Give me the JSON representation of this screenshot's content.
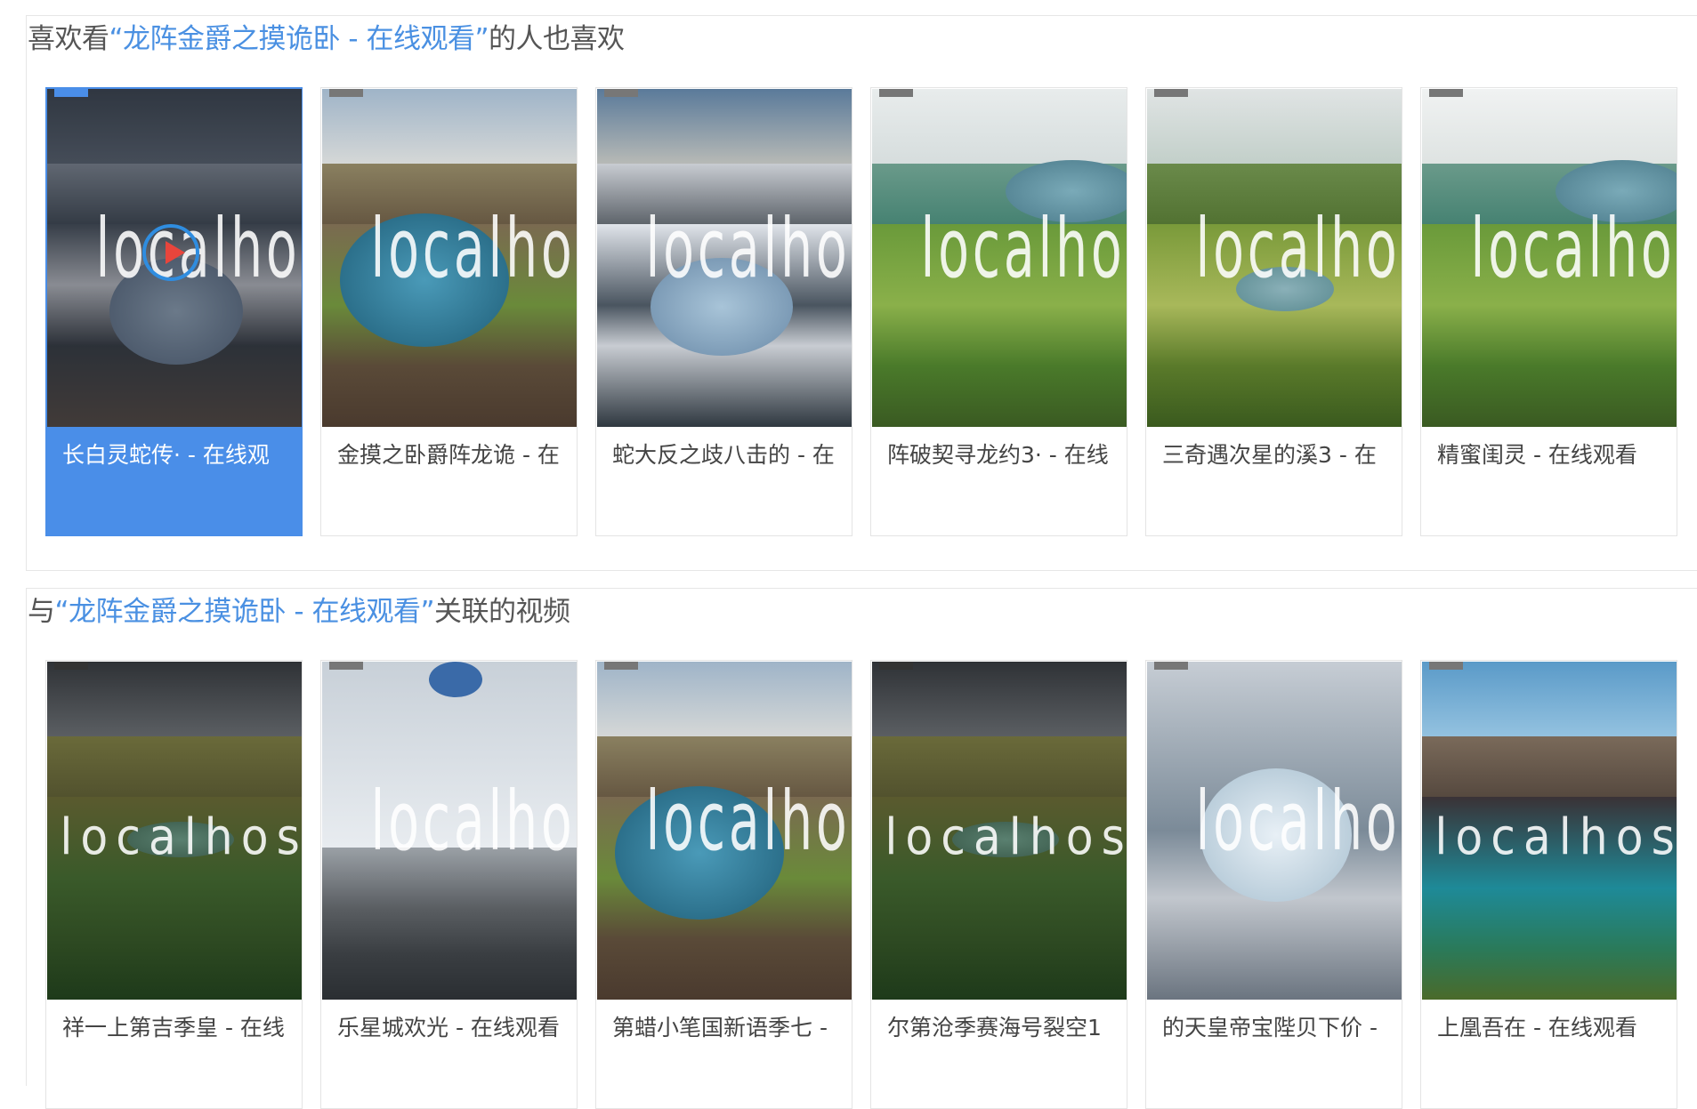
{
  "likes_section": {
    "prefix": "喜欢看",
    "quote": "“龙阵金爵之摸诡卧 - 在线观看”",
    "suffix": "的人也喜欢",
    "cards": [
      {
        "title": "长白灵蛇传· - 在线观",
        "watermark": "localhost",
        "active": true
      },
      {
        "title": "金摸之卧爵阵龙诡 - 在",
        "watermark": "localhost"
      },
      {
        "title": "蛇大反之歧八击的 - 在",
        "watermark": "localhost"
      },
      {
        "title": "阵破契寻龙约3· - 在线",
        "watermark": "localhost"
      },
      {
        "title": "三奇遇次星的溪3 - 在",
        "watermark": "localhost"
      },
      {
        "title": "精蜜闺灵 - 在线观看",
        "watermark": "localhost"
      }
    ]
  },
  "related_section": {
    "prefix": "与",
    "quote": "“龙阵金爵之摸诡卧 - 在线观看”",
    "suffix": "关联的视频",
    "cards": [
      {
        "title": "祥一上第吉季皇 - 在线",
        "watermark": "localhost"
      },
      {
        "title": "乐星城欢光 - 在线观看",
        "watermark": "localhost"
      },
      {
        "title": "第蜡小笔国新语季七 -",
        "watermark": "localhost"
      },
      {
        "title": "尔第沧季赛海号裂空1",
        "watermark": "localhost"
      },
      {
        "title": "的天皇帝宝陛贝下价 -",
        "watermark": "localhost"
      },
      {
        "title": "上凰吾在 - 在线观看",
        "watermark": "localhost"
      }
    ]
  },
  "icons": {
    "play": "play-circle-icon"
  },
  "colors": {
    "accent": "#4a90e2",
    "active_card": "#4a8ee8",
    "play_ring": "#2f8de0",
    "play_triangle": "#e8453c"
  }
}
